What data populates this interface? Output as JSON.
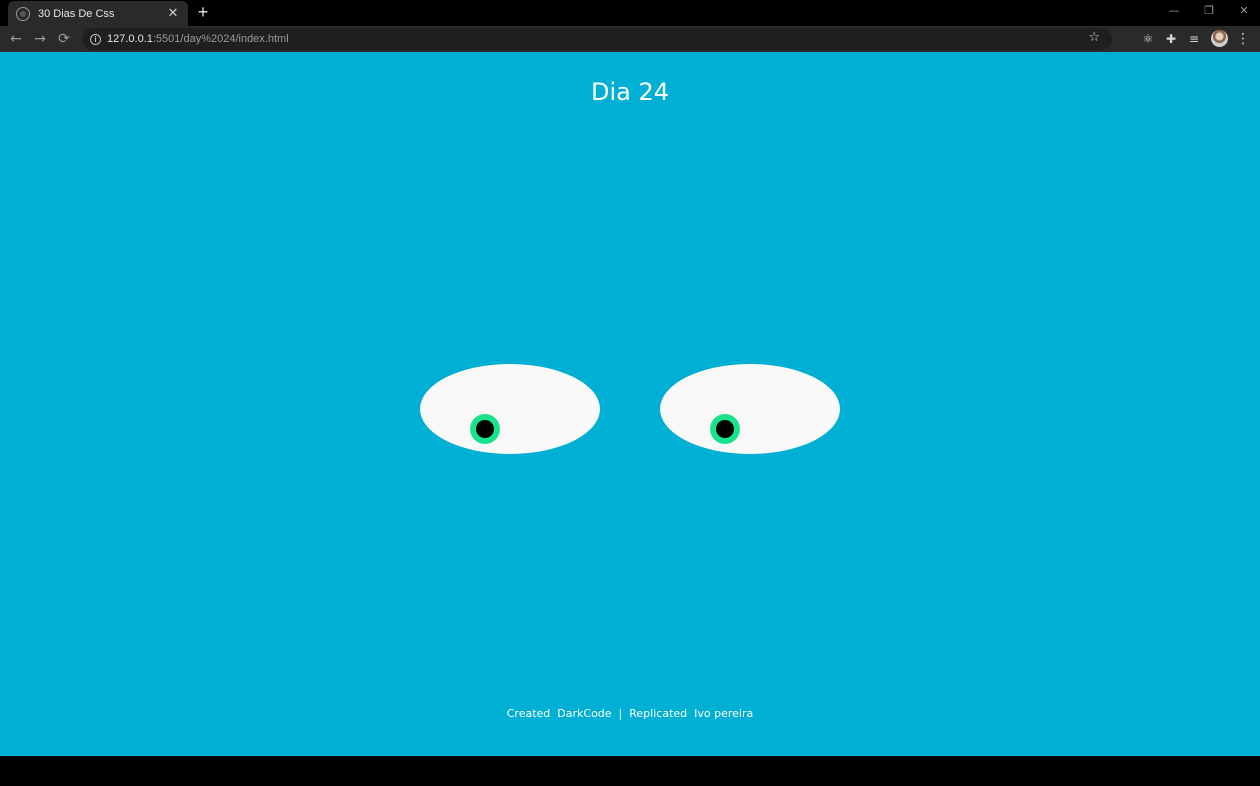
{
  "browser": {
    "tab": {
      "title": "30 Dias De Css",
      "close_glyph": "✕"
    },
    "new_tab_glyph": "+",
    "window_controls": {
      "minimize": "—",
      "restore": "❐",
      "close": "✕"
    },
    "nav": {
      "back": "←",
      "forward": "→",
      "reload": "⟳"
    },
    "address": {
      "host": "127.0.0.1",
      "rest": ":5501/day%2024/index.html"
    },
    "icons": [
      "info-icon",
      "star-icon",
      "react-devtools-icon",
      "extensions-icon",
      "reading-list-icon",
      "profile-avatar",
      "menu-icon"
    ]
  },
  "page": {
    "title": "Dia 24",
    "footer": {
      "created_label": "Created",
      "created_by": "DarkCode",
      "separator": "|",
      "replicated_label": "Replicated",
      "replicated_by": "Ivo pereira"
    }
  },
  "colors": {
    "background": "#00afd4",
    "eye_white": "#f9f9f9",
    "iris": "#18e28a",
    "pupil": "#000000",
    "text": "#ffffff"
  }
}
